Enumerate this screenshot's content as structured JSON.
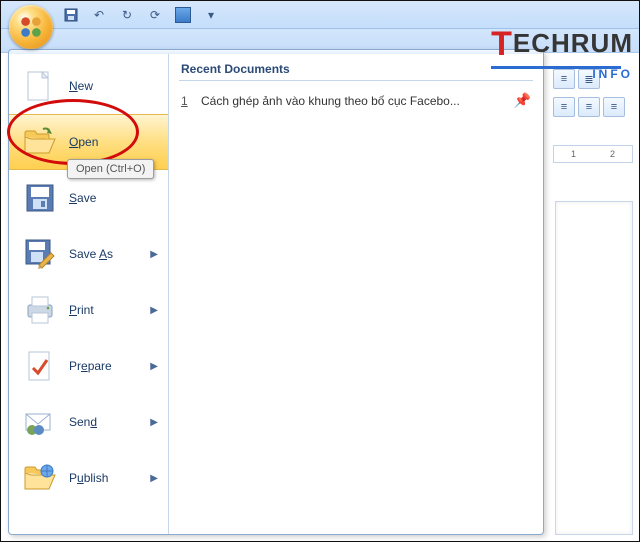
{
  "qat": {
    "save": "Save",
    "undo": "Undo",
    "redo": "Redo",
    "repeat": "Repeat",
    "table": "Table"
  },
  "watermark": {
    "brand_t": "T",
    "brand_rest": "ECHRUM",
    "sub": "INFO"
  },
  "menu": {
    "items": [
      {
        "label_pre": "",
        "accel": "N",
        "label_post": "ew",
        "has_sub": false,
        "icon": "new"
      },
      {
        "label_pre": "",
        "accel": "O",
        "label_post": "pen",
        "has_sub": false,
        "icon": "open",
        "highlight": true
      },
      {
        "label_pre": "",
        "accel": "S",
        "label_post": "ave",
        "has_sub": false,
        "icon": "save"
      },
      {
        "label_pre": "Save ",
        "accel": "A",
        "label_post": "s",
        "has_sub": true,
        "icon": "saveas"
      },
      {
        "label_pre": "",
        "accel": "P",
        "label_post": "rint",
        "has_sub": true,
        "icon": "print"
      },
      {
        "label_pre": "Pr",
        "accel": "e",
        "label_post": "pare",
        "has_sub": true,
        "icon": "prepare"
      },
      {
        "label_pre": "Sen",
        "accel": "d",
        "label_post": "",
        "has_sub": true,
        "icon": "send"
      },
      {
        "label_pre": "P",
        "accel": "u",
        "label_post": "blish",
        "has_sub": true,
        "icon": "publish"
      }
    ]
  },
  "tooltip": {
    "text": "Open (Ctrl+O)"
  },
  "recent": {
    "header": "Recent Documents",
    "items": [
      {
        "num": "1",
        "title": "Cách ghép ảnh vào khung theo bố cục Facebo..."
      }
    ]
  },
  "ruler": {
    "a": "1",
    "b": "2"
  }
}
